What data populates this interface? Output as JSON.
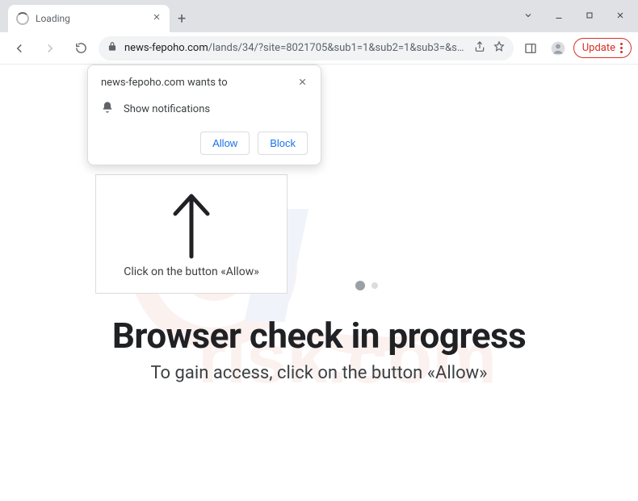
{
  "window": {
    "tab_title": "Loading"
  },
  "toolbar": {
    "url_domain": "news-fepoho.com",
    "url_path": "/lands/34/?site=8021705&sub1=1&sub2=1&sub3=&sub…",
    "update_label": "Update"
  },
  "permission": {
    "title": "news-fepoho.com wants to",
    "body": "Show notifications",
    "allow": "Allow",
    "block": "Block"
  },
  "hint": {
    "label": "Click on the button «Allow»"
  },
  "page": {
    "headline": "Browser check in progress",
    "subline": "To gain access, click on the button «Allow»"
  }
}
